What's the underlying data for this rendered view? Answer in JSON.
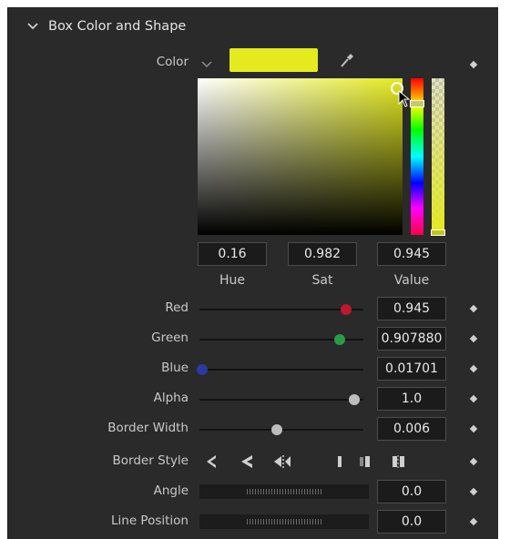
{
  "section": {
    "title": "Box Color and Shape"
  },
  "color": {
    "label": "Color",
    "swatch": "#e4ea1e",
    "hue": "0.16",
    "sat": "0.982",
    "value": "0.945",
    "hue_label": "Hue",
    "sat_label": "Sat",
    "value_label": "Value"
  },
  "params": [
    {
      "label": "Red",
      "value": "0.945",
      "fraction": 0.945,
      "knob_color": "#c0182d"
    },
    {
      "label": "Green",
      "value": "0.907880",
      "fraction": 0.9079,
      "knob_color": "#2a9a46"
    },
    {
      "label": "Blue",
      "value": "0.01701",
      "fraction": 0.017,
      "knob_color": "#2b3aa0"
    },
    {
      "label": "Alpha",
      "value": "1.0",
      "fraction": 1.0,
      "knob_color": "#bdbdbd"
    },
    {
      "label": "Border Width",
      "value": "0.006",
      "fraction": 0.5,
      "knob_color": "#bdbdbd"
    }
  ],
  "border_style": {
    "label": "Border Style"
  },
  "angle": {
    "label": "Angle",
    "value": "0.0"
  },
  "line_position": {
    "label": "Line Position",
    "value": "0.0"
  },
  "icons": [
    "chevron-down-icon",
    "eyedropper-icon",
    "keyframe-diamond-icon",
    "cursor-icon"
  ]
}
